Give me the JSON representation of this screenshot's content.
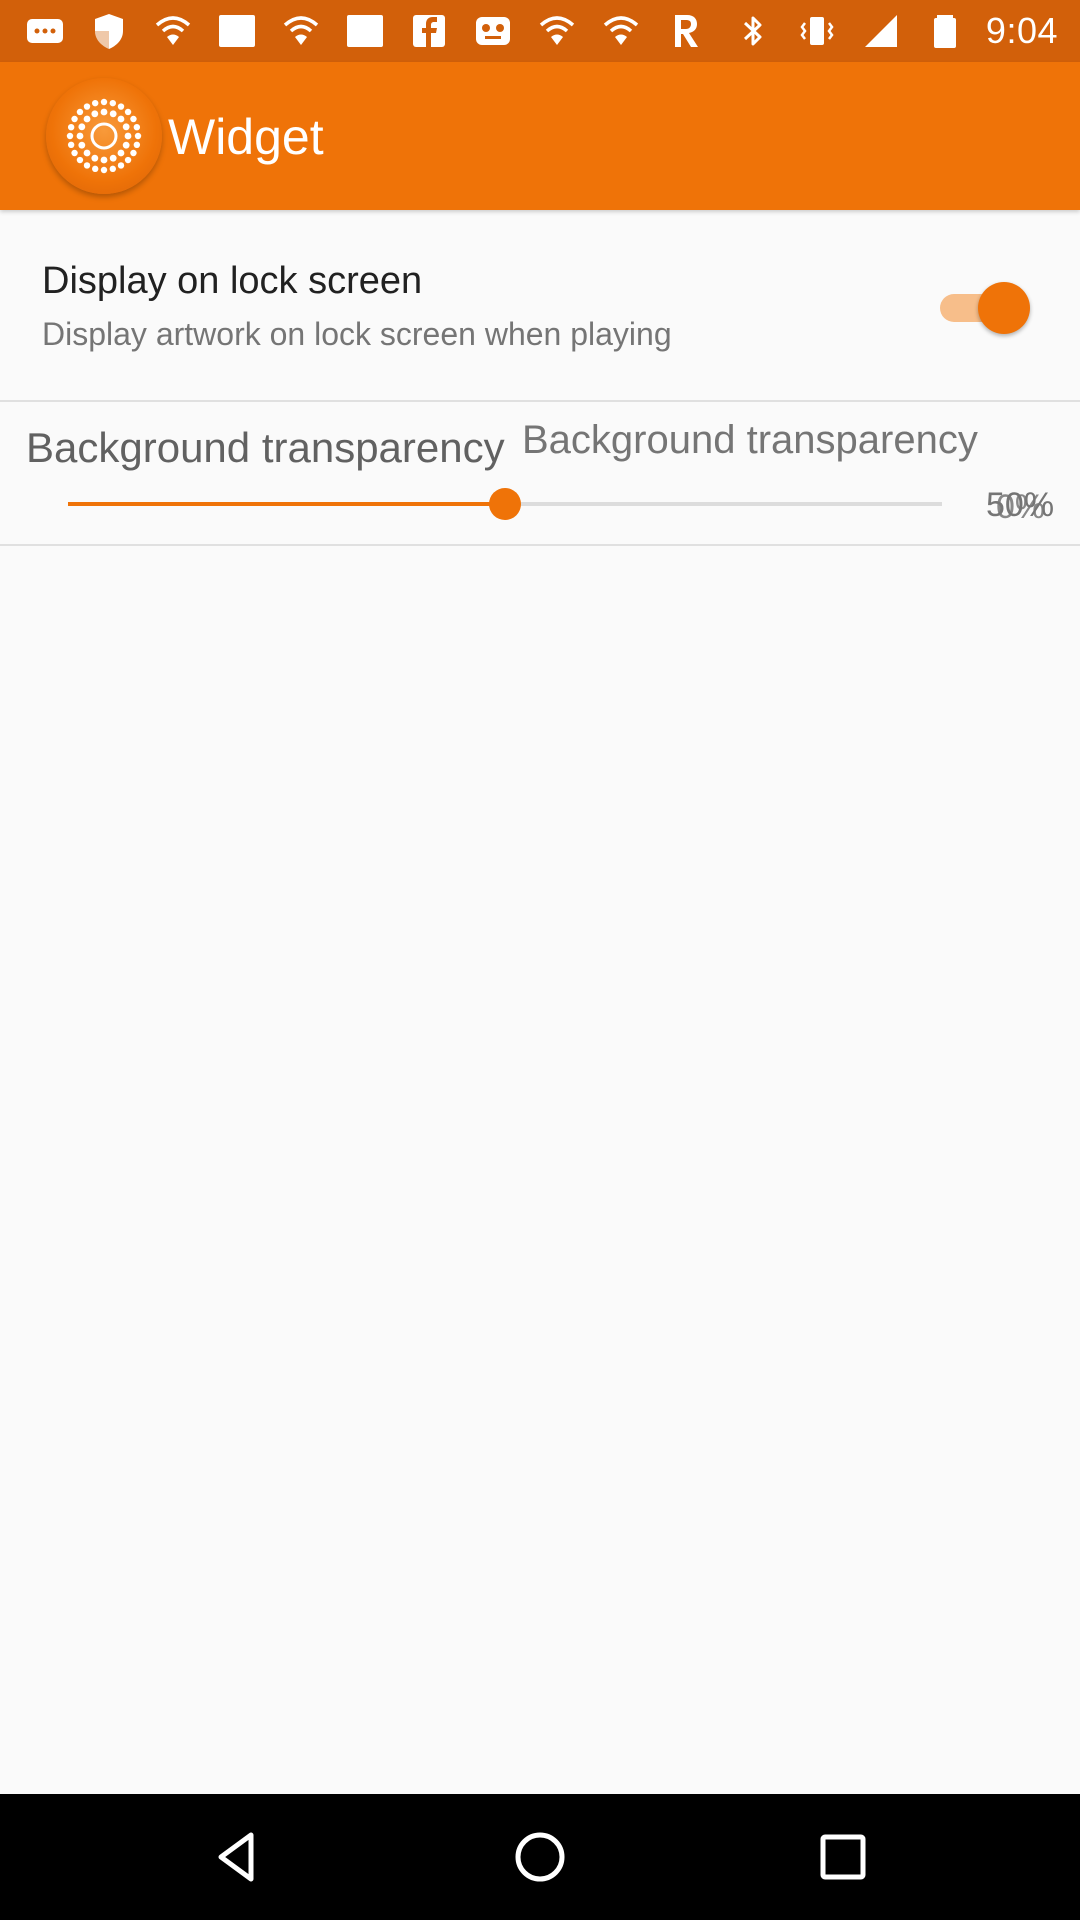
{
  "status_bar": {
    "time": "9:04",
    "left_icons": [
      "messages-icon",
      "shield-icon",
      "wifi-icon",
      "white-square-icon",
      "wifi-icon",
      "white-square-icon",
      "facebook-icon",
      "game-controller-icon",
      "wifi-icon",
      "wifi-icon",
      "r-app-icon"
    ],
    "right_icons": [
      "bluetooth-icon",
      "vibrate-icon",
      "signal-icon",
      "battery-icon"
    ]
  },
  "app_bar": {
    "title": "Widget",
    "logo_icon": "app-logo-icon"
  },
  "settings": {
    "lock_screen": {
      "title": "Display on lock screen",
      "summary": "Display artwork on lock screen when playing",
      "enabled": true
    },
    "transparency": {
      "title": "Background transparency",
      "title_overlap": "Background transparency",
      "value_label": "50%",
      "value_label_overlap": "0%",
      "value_fraction": 0.5
    }
  },
  "nav_bar": {
    "icons": [
      "back-icon",
      "home-icon",
      "recents-icon"
    ]
  },
  "colors": {
    "status_bar": "#d2600a",
    "app_bar": "#ef7308",
    "accent": "#ef7308",
    "background": "#fafafa"
  }
}
